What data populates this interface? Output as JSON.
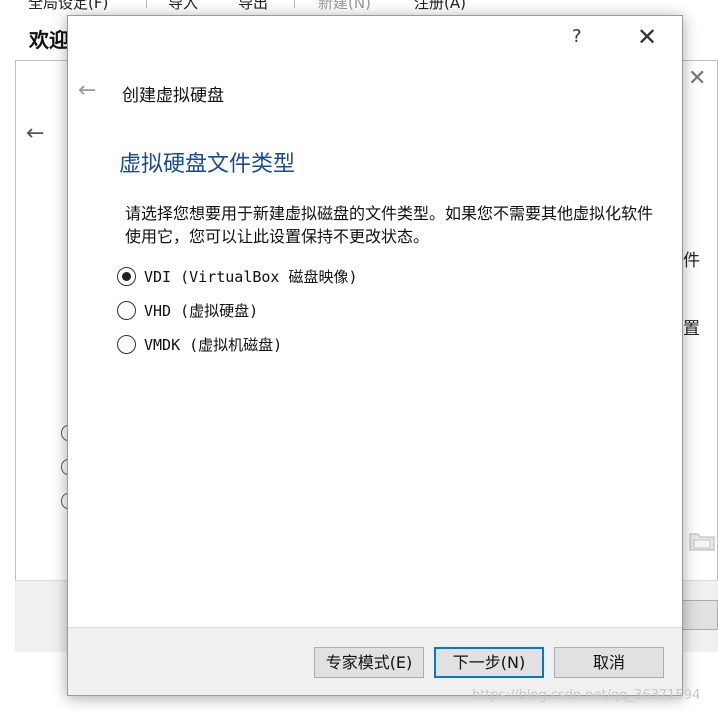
{
  "background_window": {
    "menu": [
      "全局设定(F)",
      "导入",
      "导出",
      "新建(N)",
      "注册(A)"
    ],
    "title": "欢迎",
    "right_texts": [
      "件",
      "置"
    ]
  },
  "dialog": {
    "help_symbol": "?",
    "close_symbol": "✕",
    "back_symbol": "←",
    "header": "创建虚拟硬盘",
    "title": "虚拟硬盘文件类型",
    "description": "请选择您想要用于新建虚拟磁盘的文件类型。如果您不需要其他虚拟化软件使用它，您可以让此设置保持不更改状态。",
    "options": [
      {
        "label": "VDI (VirtualBox 磁盘映像)",
        "checked": true
      },
      {
        "label": "VHD (虚拟硬盘)",
        "checked": false
      },
      {
        "label": "VMDK (虚拟机磁盘)",
        "checked": false
      }
    ],
    "buttons": {
      "expert": "专家模式(E)",
      "next": "下一步(N)",
      "cancel": "取消"
    }
  },
  "watermark": "https://blog.csdn.net/qq_36371594",
  "colors": {
    "title_blue": "#1a4a9c",
    "focus_blue": "#0078d7",
    "footer_gray": "#f0f0f0"
  }
}
